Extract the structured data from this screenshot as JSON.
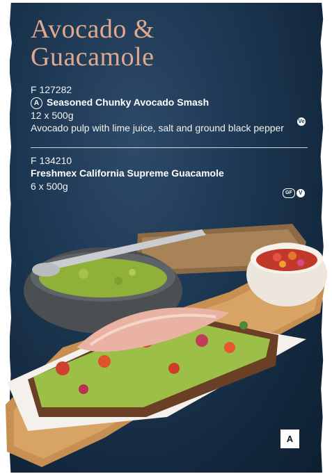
{
  "title": {
    "line1": "Avocado &",
    "line2": "Guacamole"
  },
  "products": [
    {
      "code": "F 127282",
      "badge": "A",
      "name": "Seasoned Chunky Avocado Smash",
      "size": "12 x 500g",
      "description": "Avocado pulp with lime juice, salt and ground black pepper",
      "diet_icons": [
        "vegan-icon"
      ]
    },
    {
      "code": "F 134210",
      "name": "Freshmex California Supreme Guacamole",
      "size": "6 x 500g",
      "diet_icons": [
        "gluten-free-icon",
        "vegetarian-icon"
      ]
    }
  ],
  "corner_label": "A",
  "colors": {
    "panel": "#1f3a56",
    "title": "#e0a88e",
    "guacamole": "#8fb13a"
  }
}
